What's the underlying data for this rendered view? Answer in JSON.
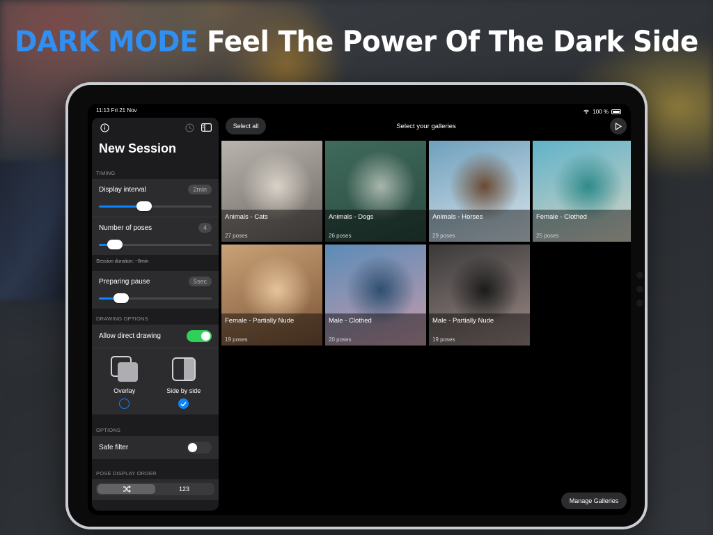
{
  "headline": {
    "accent": "DARK MODE",
    "rest": "Feel The Power Of The Dark Side"
  },
  "status_bar": {
    "time_date": "11:13  Fri 21 Nov",
    "battery": "100 %"
  },
  "sidebar": {
    "title": "New Session",
    "timing": {
      "label": "TIMING",
      "display_interval": {
        "label": "Display interval",
        "value": "2min",
        "slider_fraction": 0.4
      },
      "number_of_poses": {
        "label": "Number of poses",
        "value": "4",
        "slider_fraction": 0.14
      },
      "session_duration": "Session duration: ~8min",
      "preparing_pause": {
        "label": "Preparing pause",
        "value": "5sec",
        "slider_fraction": 0.2
      }
    },
    "drawing_options": {
      "label": "DRAWING OPTIONS",
      "allow_direct_drawing": {
        "label": "Allow direct drawing",
        "on": true
      },
      "modes": [
        {
          "label": "Overlay",
          "selected": false
        },
        {
          "label": "Side by side",
          "selected": true
        }
      ]
    },
    "options": {
      "label": "OPTIONS",
      "safe_filter": {
        "label": "Safe filter",
        "on": false
      }
    },
    "pose_display_order": {
      "label": "POSE DISPLAY ORDER",
      "segments": [
        {
          "label": "shuffle-icon",
          "active": true
        },
        {
          "label": "123",
          "active": false
        }
      ]
    }
  },
  "main": {
    "select_all": "Select all",
    "title": "Select your galleries",
    "manage_galleries": "Manage Galleries",
    "galleries": [
      {
        "name": "Animals - Cats",
        "count": "27 poses",
        "colors": [
          "#b9b4ae",
          "#6b6560",
          "#d8d2c8"
        ]
      },
      {
        "name": "Animals - Dogs",
        "count": "26 poses",
        "colors": [
          "#3f6a5c",
          "#2b4a40",
          "#a9b6ad"
        ]
      },
      {
        "name": "Animals - Horses",
        "count": "29 poses",
        "colors": [
          "#6fa0bd",
          "#d9e4ea",
          "#6a4a33"
        ]
      },
      {
        "name": "Female - Clothed",
        "count": "25 poses",
        "colors": [
          "#5fb3c9",
          "#d9d3c2",
          "#2f8a8a"
        ]
      },
      {
        "name": "Female - Partially Nude",
        "count": "19 poses",
        "colors": [
          "#c9a277",
          "#7a5236",
          "#e6c49a"
        ]
      },
      {
        "name": "Male - Clothed",
        "count": "20 poses",
        "colors": [
          "#5b8cb8",
          "#c89aa9",
          "#2e4f70"
        ]
      },
      {
        "name": "Male - Partially Nude",
        "count": "19 poses",
        "colors": [
          "#3a3a3a",
          "#9c8a86",
          "#1b1b1b"
        ]
      }
    ]
  }
}
